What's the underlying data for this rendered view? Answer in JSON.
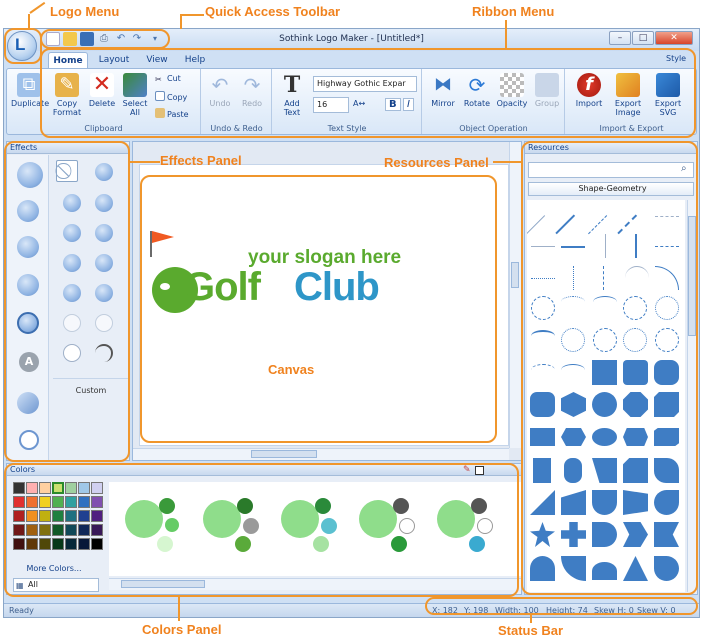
{
  "annotations": {
    "logo_menu": "Logo Menu",
    "quick_access": "Quick Access Toolbar",
    "ribbon_menu": "Ribbon Menu",
    "effects_panel": "Effects Panel",
    "resources_panel": "Resources Panel",
    "canvas": "Canvas",
    "colors_panel": "Colors Panel",
    "status_bar": "Status Bar"
  },
  "window": {
    "title": "Sothink Logo Maker - [Untitled*]",
    "style_label": "Style"
  },
  "tabs": [
    "Home",
    "Layout",
    "View",
    "Help"
  ],
  "ribbon": {
    "clipboard": {
      "label": "Clipboard",
      "duplicate": "Duplicate",
      "copy_format": "Copy Format",
      "delete": "Delete",
      "select_all": "Select All",
      "cut": "Cut",
      "copy": "Copy",
      "paste": "Paste"
    },
    "undo_redo": {
      "label": "Undo & Redo",
      "undo": "Undo",
      "redo": "Redo"
    },
    "text_style": {
      "label": "Text Style",
      "add_text": "Add Text",
      "font": "Highway Gothic Expar",
      "size": "16",
      "bold": "B",
      "italic": "I"
    },
    "object_operation": {
      "label": "Object Operation",
      "mirror": "Mirror",
      "rotate": "Rotate",
      "opacity": "Opacity",
      "group": "Group"
    },
    "import_export": {
      "label": "Import & Export",
      "import": "Import",
      "export_image": "Export Image",
      "export_svg": "Export SVG"
    }
  },
  "effects": {
    "title": "Effects",
    "custom": "Custom"
  },
  "canvas": {
    "slogan": "your slogan here",
    "golf": "Golf",
    "club": "Club"
  },
  "resources": {
    "title": "Resources",
    "category": "Shape-Geometry"
  },
  "colors": {
    "title": "Colors",
    "more_colors": "More Colors...",
    "palette": "All"
  },
  "status": {
    "ready": "Ready",
    "x": "X: 182",
    "y": "Y: 198",
    "width": "Width: 100",
    "height": "Height: 74",
    "skew_h": "Skew H: 0",
    "skew_v": "Skew V: 0"
  },
  "theme": {
    "accent": "#f0962c",
    "golf_green": "#5aaa2e",
    "club_blue": "#2e96c8",
    "flag": "#f05a22"
  }
}
